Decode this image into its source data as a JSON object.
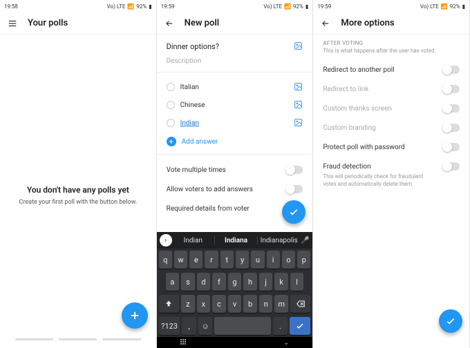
{
  "status": {
    "time1": "19:58",
    "time2": "19:59",
    "time3": "19:59",
    "battery": "92%",
    "net": "Vo) LTE"
  },
  "screen1": {
    "title": "Your polls",
    "empty_title": "You don't have any polls yet",
    "empty_sub": "Create your first poll with the button below."
  },
  "screen2": {
    "title": "New poll",
    "question": "Dinner options?",
    "desc": "Description",
    "options": [
      "Italian",
      "Chinese",
      "Indian"
    ],
    "add": "Add answer",
    "toggles": [
      "Vote multiple times",
      "Allow voters to add answers",
      "Required details from voter"
    ],
    "suggestions": [
      "Indian",
      "Indiana",
      "Indianapolis"
    ],
    "keys_r1": [
      "q",
      "w",
      "e",
      "r",
      "t",
      "y",
      "u",
      "i",
      "o",
      "p"
    ],
    "keys_r2": [
      "a",
      "s",
      "d",
      "f",
      "g",
      "h",
      "j",
      "k",
      "l"
    ],
    "keys_r3": [
      "z",
      "x",
      "c",
      "v",
      "b",
      "n",
      "m"
    ],
    "sym": "?123"
  },
  "screen3": {
    "title": "More options",
    "section": "AFTER VOTING",
    "section_sub": "This is what happens after the user has voted.",
    "items": [
      {
        "label": "Redirect to another poll",
        "disabled": false
      },
      {
        "label": "Redirect to link",
        "disabled": true
      },
      {
        "label": "Custom thanks screen",
        "disabled": true
      },
      {
        "label": "Custom branding",
        "disabled": true
      },
      {
        "label": "Protect poll with password",
        "disabled": false
      }
    ],
    "fraud": {
      "label": "Fraud detection",
      "sub": "This will periodically check for fraudulent votes and automatically delete them."
    }
  }
}
